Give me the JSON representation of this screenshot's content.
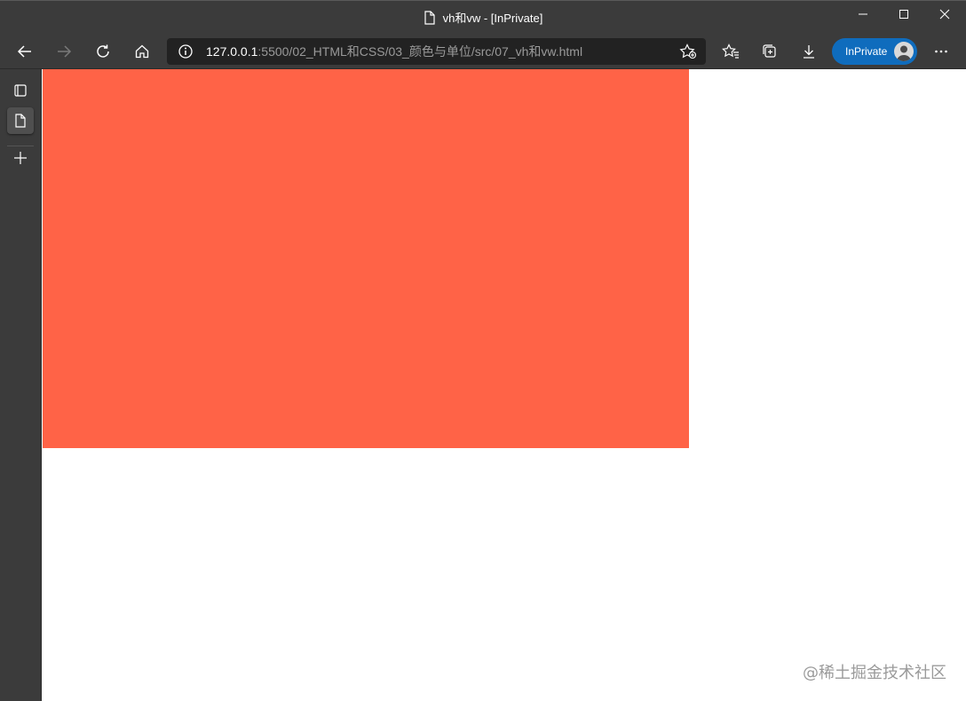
{
  "window": {
    "title": "vh和vw - [InPrivate]",
    "controls": [
      "minimize",
      "maximize",
      "close"
    ]
  },
  "toolbar": {
    "url_host": "127.0.0.1",
    "url_path": ":5500/02_HTML和CSS/03_颜色与单位/src/07_vh和vw.html",
    "inprivate_label": "InPrivate"
  },
  "icons": {
    "back": "back-arrow-icon",
    "forward": "forward-arrow-icon",
    "refresh": "refresh-icon",
    "home": "home-icon",
    "site_info": "info-icon",
    "add_favorite": "star-add-icon",
    "favorites": "favorites-icon",
    "collections": "collections-icon",
    "downloads": "download-icon",
    "menu": "more-icon",
    "tab_actions": "tab-actions-icon",
    "page_tab": "page-icon",
    "new_tab": "plus-icon"
  },
  "page": {
    "box_color": "#ff6347",
    "watermark": "@稀土掘金技术社区"
  },
  "colors": {
    "chrome": "#3b3b3b",
    "address_bar": "#222222",
    "inprivate": "#0f6cbd"
  }
}
